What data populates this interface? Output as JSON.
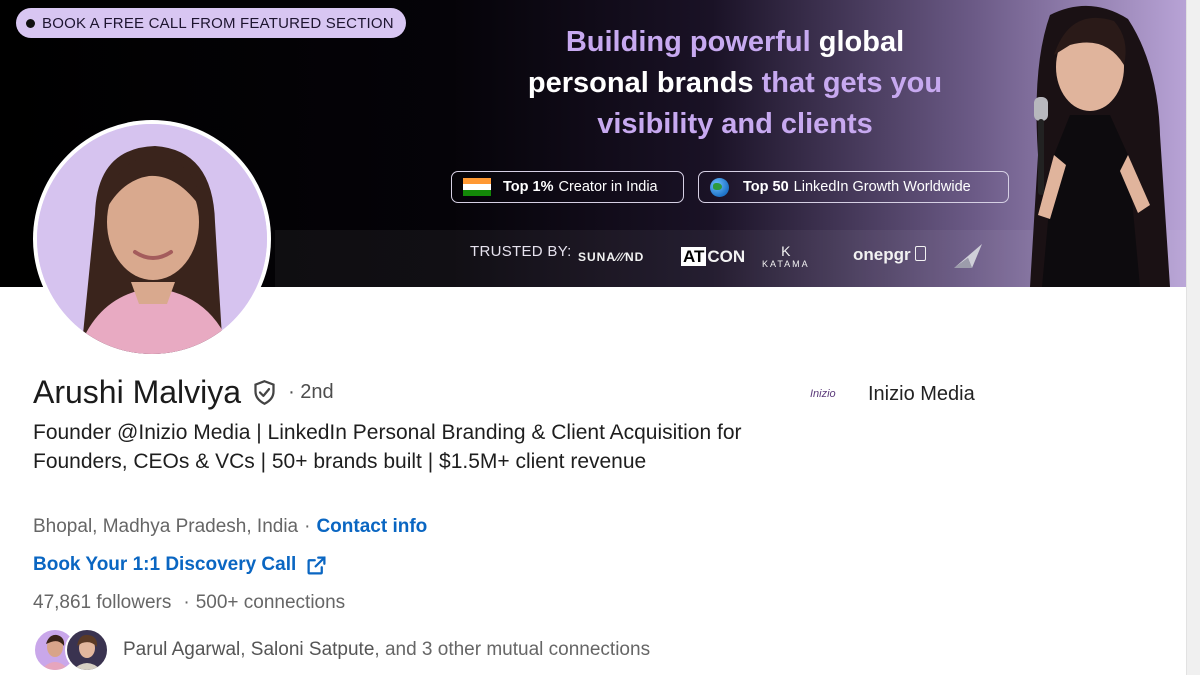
{
  "banner": {
    "cta_pill": "BOOK A FREE CALL FROM FEATURED SECTION",
    "headline": {
      "line1_purple": "Building powerful",
      "line1_white": "global",
      "line2_white": "personal brands",
      "line2_purple": "that gets you",
      "line3_purple": "visibility and clients"
    },
    "badge1": {
      "bold": "Top 1%",
      "rest": "Creator in India"
    },
    "badge2": {
      "bold": "Top 50",
      "rest": "LinkedIn Growth Worldwide"
    },
    "trusted_label": "TRUSTED BY:",
    "logos": {
      "suna": "SUNA∕∕∕ND",
      "atcon_box": "AT",
      "atcon_rest": "CON",
      "katama_k": "K",
      "katama": "KATAMA",
      "onepgr": "onepgr"
    }
  },
  "profile": {
    "name": "Arushi Malviya",
    "degree": "· 2nd",
    "headline": "Founder @Inizio Media | LinkedIn Personal Branding & Client Acquisition for Founders, CEOs & VCs | 50+ brands built | $1.5M+ client revenue",
    "location": "Bhopal, Madhya Pradesh, India",
    "location_sep": "·",
    "contact_info": "Contact info",
    "book_call": "Book Your 1:1 Discovery Call",
    "followers": "47,861 followers",
    "stats_sep": "·",
    "connections": "500+ connections",
    "mutual": {
      "name1": "Parul Agarwal",
      "sep": ",",
      "name2": "Saloni Satpute",
      "rest": ", and 3 other mutual connections"
    }
  },
  "company": {
    "logo_text": "Inizio",
    "name": "Inizio Media"
  },
  "colors": {
    "link": "#0a66c2",
    "accent_purple": "#c7a9f0",
    "pill_bg": "#d8c6f2"
  }
}
